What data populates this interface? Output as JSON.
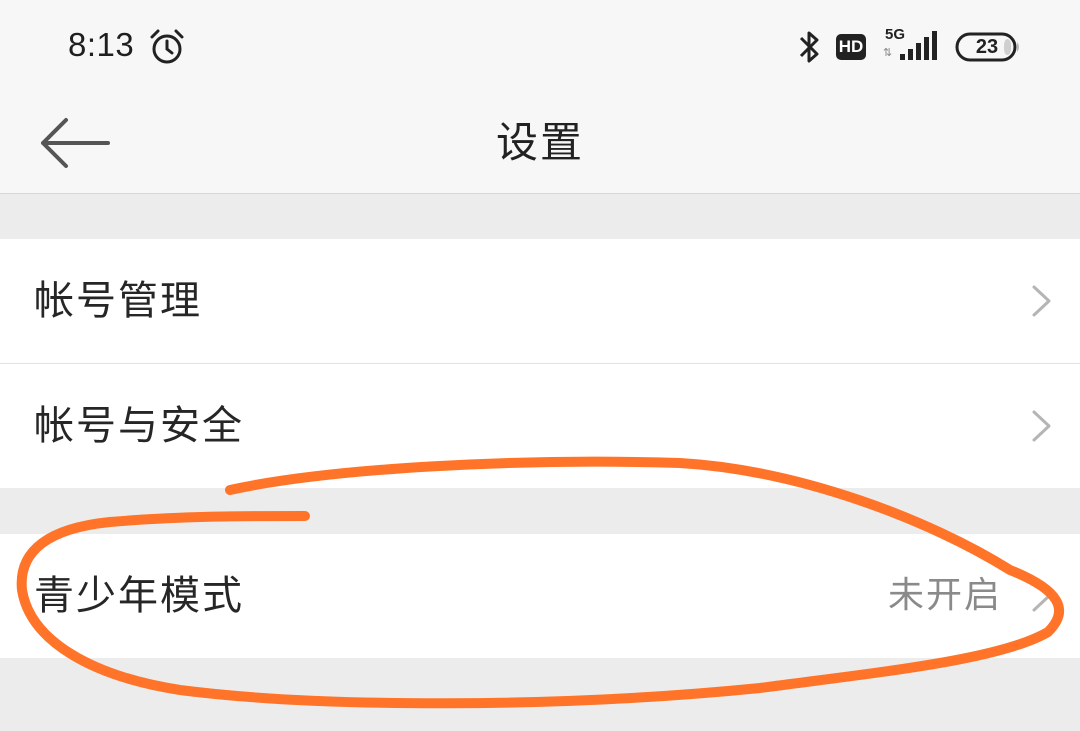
{
  "status_bar": {
    "time": "8:13",
    "icons": [
      "alarm-icon",
      "bluetooth-icon",
      "hd-icon",
      "signal-5g-icon",
      "battery-icon"
    ],
    "hd_label": "HD",
    "network": "5G",
    "network_arrows": "⇅",
    "battery": "23"
  },
  "header": {
    "title": "设置",
    "back_icon": "arrow-left-icon"
  },
  "settings": {
    "items": [
      {
        "label": "帐号管理",
        "value": ""
      },
      {
        "label": "帐号与安全",
        "value": ""
      },
      {
        "label": "青少年模式",
        "value": "未开启"
      }
    ]
  },
  "colors": {
    "background": "#ececec",
    "bar": "#f7f7f7",
    "row": "#ffffff",
    "annotation": "#ff7428",
    "secondary_text": "#8a8a8a"
  }
}
